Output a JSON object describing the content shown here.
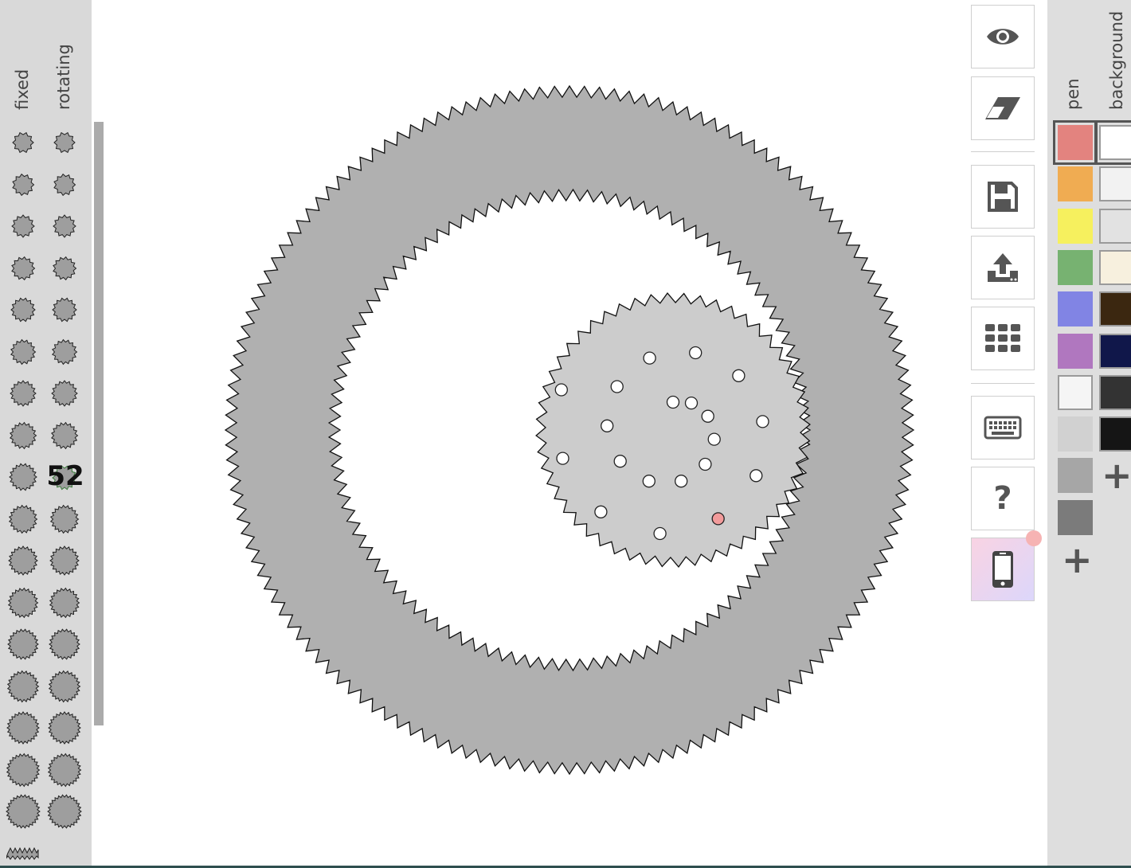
{
  "left_panel": {
    "fixed_label": "fixed",
    "rotating_label": "rotating",
    "selected_count": "52"
  },
  "canvas": {
    "outer_ring": {
      "outer_teeth": 144,
      "inner_teeth": 105
    },
    "rotating_wheel": {
      "teeth": 52,
      "holes": 20
    },
    "active_hole_color": "#f29b9b"
  },
  "toolbar": {
    "tools": [
      {
        "name": "preview-button",
        "icon": "eye-icon"
      },
      {
        "name": "eraser-button",
        "icon": "eraser-icon"
      },
      {
        "name": "save-button",
        "icon": "floppy-disk-icon"
      },
      {
        "name": "upload-button",
        "icon": "upload-icon"
      },
      {
        "name": "gallery-button",
        "icon": "grid-icon"
      },
      {
        "name": "keyboard-button",
        "icon": "keyboard-icon"
      },
      {
        "name": "help-button",
        "icon": "question-icon"
      },
      {
        "name": "mobile-button",
        "icon": "phone-icon"
      }
    ],
    "help_symbol": "?"
  },
  "colors_panel": {
    "pen_label": "pen",
    "background_label": "background",
    "pen_colors": [
      "#e3837f",
      "#f0ac52",
      "#f6f05e",
      "#77b271",
      "#8184e4",
      "#b077bf",
      "#f5f5f5",
      "#d1d1d1",
      "#a6a6a6",
      "#7b7b7b"
    ],
    "background_colors": [
      "#ffffff",
      "#f2f2f2",
      "#e2e2e2",
      "#f7f0de",
      "#3b2710",
      "#10174a",
      "#333333",
      "#151515"
    ],
    "add_label": "+"
  }
}
